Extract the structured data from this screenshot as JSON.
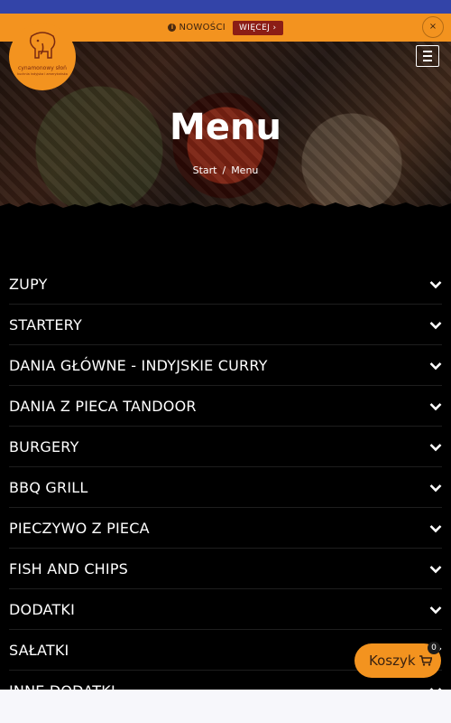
{
  "promo": {
    "label": "NOWOŚCI",
    "more": "WIĘCEJ ›",
    "close": "×"
  },
  "logo": {
    "name": "cynamonowy słoń",
    "tagline": "kuchnia indyjska i amerykańska"
  },
  "hero": {
    "title": "Menu",
    "crumbs": [
      "Start",
      "Menu"
    ],
    "separator": "/"
  },
  "categories": [
    "ZUPY",
    "STARTERY",
    "DANIA GŁÓWNE - INDYJSKIE CURRY",
    "DANIA Z PIECA TANDOOR",
    "BURGERY",
    "BBQ GRILL",
    "PIECZYWO Z PIECA",
    "FISH AND CHIPS",
    "DODATKI",
    "SAŁATKI",
    "INNE DODATKI"
  ],
  "cart": {
    "label": "Koszyk",
    "count": "0"
  },
  "colors": {
    "accent": "#f3931f",
    "topbar": "#3344a8",
    "more_button": "#8b1d16"
  },
  "icons": {
    "info": "info-icon",
    "close": "close-icon",
    "menu": "hamburger-icon",
    "chevron": "chevron-down-icon",
    "cart": "shopping-cart-icon"
  }
}
